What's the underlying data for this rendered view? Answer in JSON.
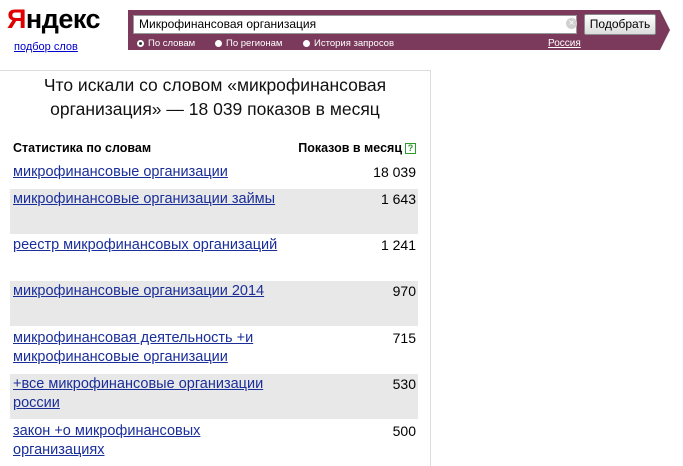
{
  "header": {
    "logo_first": "Я",
    "logo_rest": "ндекс",
    "sublogo": "подбор слов"
  },
  "search": {
    "value": "Микрофинансовая организация",
    "clear_glyph": "×",
    "submit_label": "Подобрать",
    "options": [
      {
        "label": "По словам",
        "selected": true
      },
      {
        "label": "По регионам",
        "selected": false
      },
      {
        "label": "История запросов",
        "selected": false
      }
    ],
    "region": "Россия"
  },
  "results": {
    "title": "Что искали со словом «микрофинансовая организация» — 18 039 показов в месяц",
    "col_words": "Статистика по словам",
    "col_shows": "Показов в месяц",
    "help_glyph": "?",
    "rows": [
      {
        "phrase": "микрофинансовые организации",
        "count": "18 039"
      },
      {
        "phrase": "микрофинансовые организации займы",
        "count": "1 643"
      },
      {
        "phrase": "реестр микрофинансовых организаций",
        "count": "1 241"
      },
      {
        "phrase": "микрофинансовые организации 2014",
        "count": "970"
      },
      {
        "phrase": "микрофинансовая деятельность +и микрофинансовые организации",
        "count": "715"
      },
      {
        "phrase": "+все микрофинансовые организации россии",
        "count": "530"
      },
      {
        "phrase": "закон +о микрофинансовых организациях",
        "count": "500"
      }
    ]
  },
  "colors": {
    "search_bar": "#7b3a5c",
    "link": "#1a2e99",
    "row_shade": "#e8e8e8",
    "logo_red": "#e00000"
  }
}
